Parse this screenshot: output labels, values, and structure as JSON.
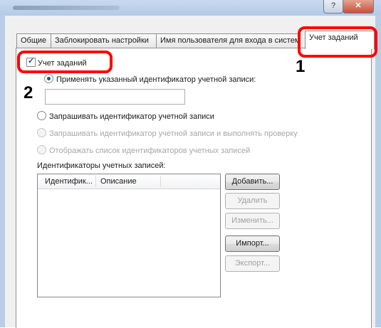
{
  "window": {
    "help_glyph": "?",
    "close_glyph": "✕"
  },
  "tabs": [
    {
      "label": "Общие"
    },
    {
      "label": "Заблокировать настройки"
    },
    {
      "label": "Имя пользователя для входа в систем"
    },
    {
      "label": "Учет заданий",
      "active": true
    }
  ],
  "job_accounting": {
    "checkbox_label": "Учет заданий",
    "checked": true
  },
  "options": {
    "apply_specified": "Применять указанный идентификатор учетной записи:",
    "account_id_value": "",
    "prompt_id": "Запрашивать идентификатор учетной записи",
    "prompt_and_validate": "Запрашивать идентификатор учетной записи и выполнять проверку",
    "display_list": "Отображать список идентификаторов учетных записей"
  },
  "accounts": {
    "label": "Идентификаторы учетных записей:",
    "columns": [
      "Идентифик...",
      "Описание"
    ],
    "rows": []
  },
  "buttons": {
    "add": "Добавить...",
    "delete": "Удалить",
    "edit": "Изменить...",
    "import": "Импорт...",
    "export": "Экспорт..."
  },
  "annotations": {
    "marker_1": "1",
    "marker_2": "2",
    "callout_color": "#ff0000"
  }
}
